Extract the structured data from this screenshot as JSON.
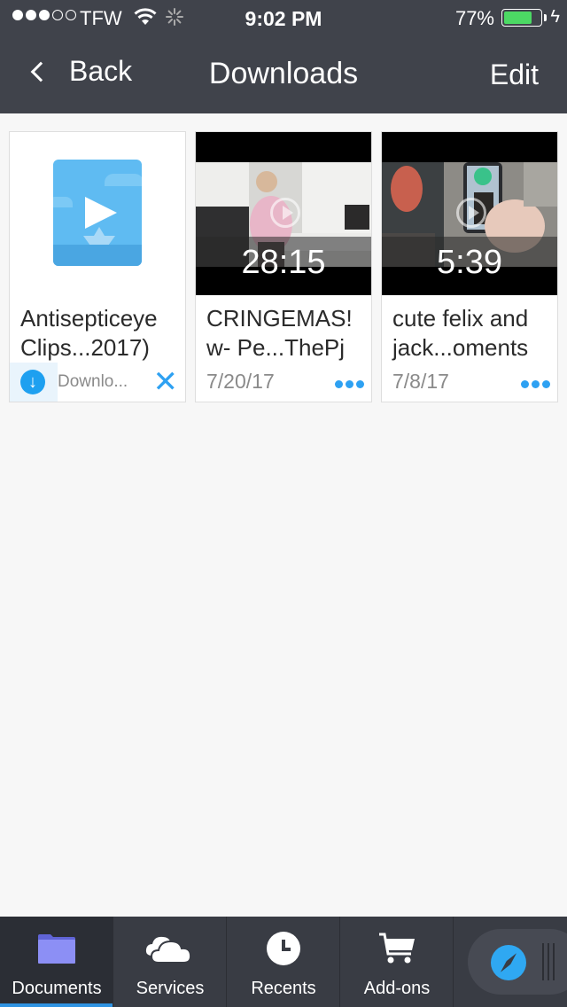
{
  "status_bar": {
    "signal_strength": "3 of 5",
    "carrier": "TFW",
    "time": "9:02 PM",
    "battery_percent": "77%",
    "battery_level": 0.77,
    "charging": true,
    "icons": [
      "wifi-icon",
      "activity-spinner-icon",
      "battery-icon",
      "charging-bolt-icon"
    ]
  },
  "nav": {
    "back_label": "Back",
    "title": "Downloads",
    "edit_label": "Edit"
  },
  "items": [
    {
      "type": "downloading",
      "title_line1": "Antisepticeye",
      "title_line2": "Clips...2017)",
      "status": "Downlo...",
      "thumbnail_icon": "video-placeholder-icon",
      "cancel_glyph": "✕",
      "download_glyph": "↓"
    },
    {
      "type": "video",
      "title_line1": "CRINGEMAS!",
      "title_line2": "w- Pe...ThePj",
      "duration": "28:15",
      "date": "7/20/17"
    },
    {
      "type": "video",
      "title_line1": "cute felix and",
      "title_line2": "jack...oments",
      "duration": "5:39",
      "date": "7/8/17"
    }
  ],
  "tabbar": {
    "tabs": [
      {
        "label": "Documents",
        "icon": "folder-icon",
        "active": true
      },
      {
        "label": "Services",
        "icon": "cloud-icon",
        "active": false
      },
      {
        "label": "Recents",
        "icon": "clock-icon",
        "active": false
      },
      {
        "label": "Add-ons",
        "icon": "cart-icon",
        "active": false
      }
    ],
    "browser_icon": "compass-icon"
  },
  "colors": {
    "nav_bg": "#40434b",
    "tabbar_bg": "#393c44",
    "accent": "#2ea1f2",
    "battery": "#4cd964",
    "folder": "#8c8ff5"
  }
}
